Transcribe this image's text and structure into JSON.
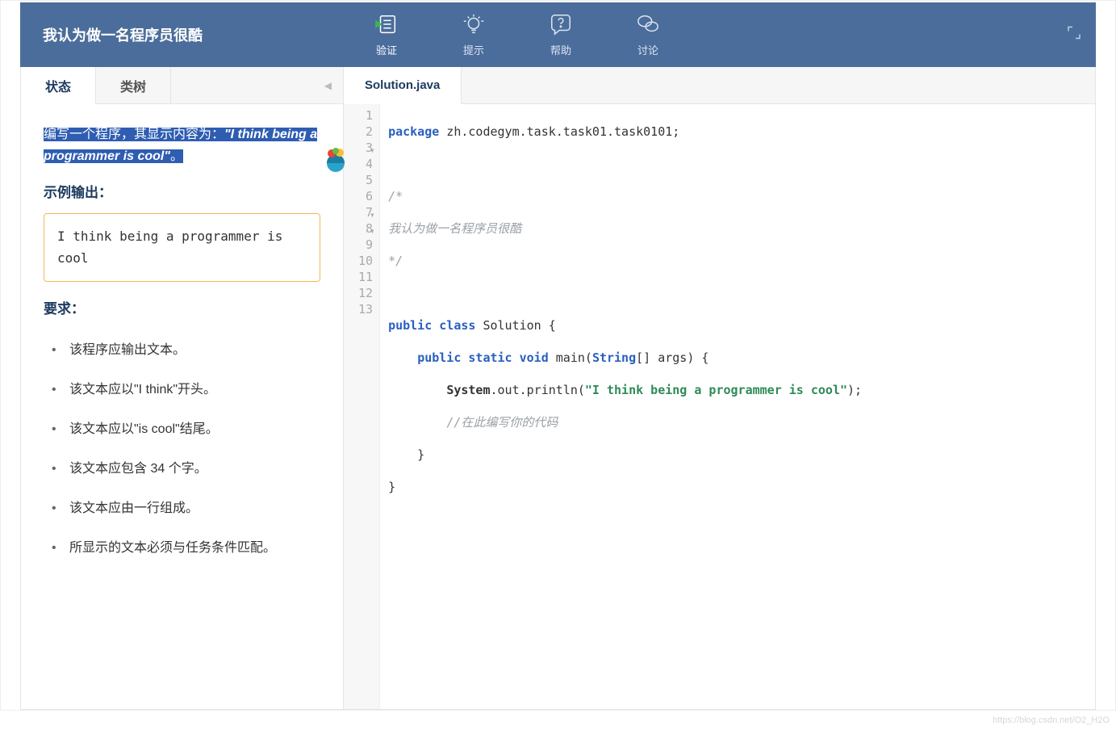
{
  "header": {
    "title": "我认为做一名程序员很酷",
    "actions": {
      "verify": "验证",
      "hint": "提示",
      "help": "帮助",
      "discuss": "讨论"
    }
  },
  "left": {
    "tabs": {
      "status": "状态",
      "tree": "类树"
    },
    "intro_plain": "编写一个程序，其显示内容为：",
    "intro_quoted": "\"I think being a programmer is cool\"",
    "intro_trailing": "。",
    "example_title": "示例输出：",
    "example_output": "I think being a programmer is cool",
    "req_title": "要求：",
    "requirements": [
      "该程序应输出文本。",
      "该文本应以\"I think\"开头。",
      "该文本应以\"is cool\"结尾。",
      "该文本应包含 34 个字。",
      "该文本应由一行组成。",
      "所显示的文本必须与任务条件匹配。"
    ]
  },
  "editor": {
    "file_tab": "Solution.java",
    "lines": {
      "l1_kw": "package",
      "l1_rest": " zh.codegym.task.task01.task0101;",
      "l3": "/*",
      "l4": "我认为做一名程序员很酷",
      "l5": "*/",
      "l7_a": "public class",
      "l7_b": " Solution {",
      "l8_a": "public static void",
      "l8_b": " main(",
      "l8_c": "String",
      "l8_d": "[] args) {",
      "l9_a": "System",
      "l9_b": ".out.println(",
      "l9_c": "\"I think being a programmer is cool\"",
      "l9_d": ");",
      "l10": "//在此编写你的代码",
      "l11": "    }",
      "l12": "}"
    },
    "line_numbers": [
      "1",
      "2",
      "3",
      "4",
      "5",
      "6",
      "7",
      "8",
      "9",
      "10",
      "11",
      "12",
      "13"
    ]
  },
  "watermark": "https://blog.csdn.net/O2_H2O"
}
